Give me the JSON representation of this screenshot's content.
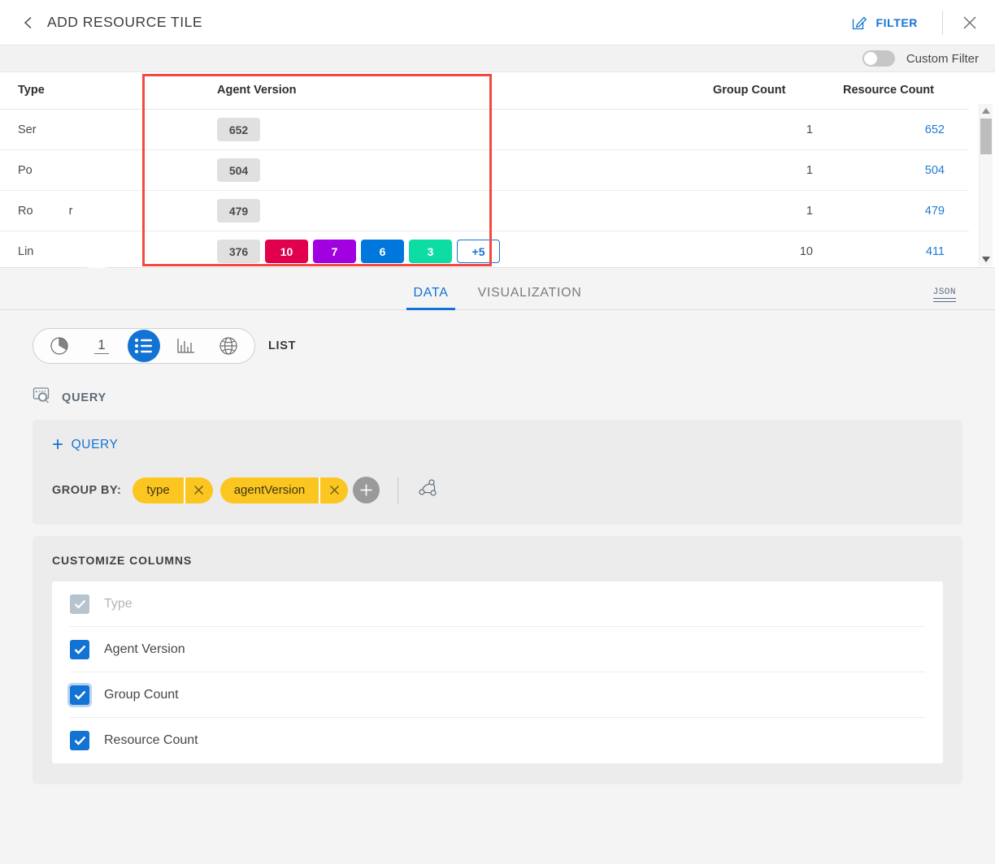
{
  "header": {
    "back_icon": "chevron-left-icon",
    "title": "ADD RESOURCE TILE",
    "filter_label": "FILTER",
    "filter_icon": "pencil-square-icon",
    "close_icon": "close-icon"
  },
  "filter_strip": {
    "toggle_state": "off",
    "label": "Custom Filter"
  },
  "table": {
    "columns": [
      "Type",
      "Agent Version",
      "Group Count",
      "Resource Count"
    ],
    "rows": [
      {
        "type": "Ser",
        "type_redacted": true,
        "agent_versions": [
          {
            "label": "652",
            "style": "gray"
          }
        ],
        "group_count": "1",
        "resource_count": "652"
      },
      {
        "type": "Po",
        "type_redacted": true,
        "agent_versions": [
          {
            "label": "504",
            "style": "gray"
          }
        ],
        "group_count": "1",
        "resource_count": "504"
      },
      {
        "type": "Ro",
        "type_redacted": true,
        "type_suffix": "r",
        "agent_versions": [
          {
            "label": "479",
            "style": "gray"
          }
        ],
        "group_count": "1",
        "resource_count": "479"
      },
      {
        "type": "Lin",
        "type_redacted": true,
        "agent_versions": [
          {
            "label": "376",
            "style": "gray"
          },
          {
            "label": "10",
            "style": "crimson"
          },
          {
            "label": "7",
            "style": "purple"
          },
          {
            "label": "6",
            "style": "blue"
          },
          {
            "label": "3",
            "style": "teal"
          },
          {
            "label": "+5",
            "style": "more"
          }
        ],
        "group_count": "10",
        "resource_count": "411"
      }
    ],
    "scrollbar": {
      "up_icon": "scroll-up-arrow-icon",
      "down_icon": "scroll-down-arrow-icon"
    },
    "annotation_highlight": "agent-version-column"
  },
  "chip_colors": {
    "gray": "#e0e0e0",
    "crimson": "#e0004d",
    "purple": "#a100e0",
    "blue": "#0077dd",
    "teal": "#0ddca5",
    "more_border": "#1273d4"
  },
  "tabs": {
    "items": [
      {
        "label": "DATA",
        "active": true
      },
      {
        "label": "VISUALIZATION",
        "active": false
      }
    ],
    "json_label": "JSON"
  },
  "visualization": {
    "options": [
      {
        "name": "pie-chart-icon",
        "selected": false
      },
      {
        "name": "single-value-icon",
        "selected": false,
        "value": "1"
      },
      {
        "name": "list-icon",
        "selected": true
      },
      {
        "name": "bar-chart-icon",
        "selected": false
      },
      {
        "name": "globe-icon",
        "selected": false
      }
    ],
    "selected_label": "LIST"
  },
  "query": {
    "section_icon": "query-search-icon",
    "section_label": "QUERY",
    "add_query_label": "QUERY",
    "add_query_plus": "+",
    "group_by_label": "GROUP BY:",
    "group_by_chips": [
      {
        "label": "type",
        "remove_icon": "close-icon"
      },
      {
        "label": "agentVersion",
        "remove_icon": "close-icon"
      }
    ],
    "add_chip_icon": "plus-icon",
    "topology_icon": "topology-graph-icon"
  },
  "customize_columns": {
    "title": "CUSTOMIZE COLUMNS",
    "items": [
      {
        "label": "Type",
        "checked": true,
        "disabled": true,
        "focused": false
      },
      {
        "label": "Agent Version",
        "checked": true,
        "disabled": false,
        "focused": false
      },
      {
        "label": "Group Count",
        "checked": true,
        "disabled": false,
        "focused": true
      },
      {
        "label": "Resource Count",
        "checked": true,
        "disabled": false,
        "focused": false
      }
    ]
  }
}
